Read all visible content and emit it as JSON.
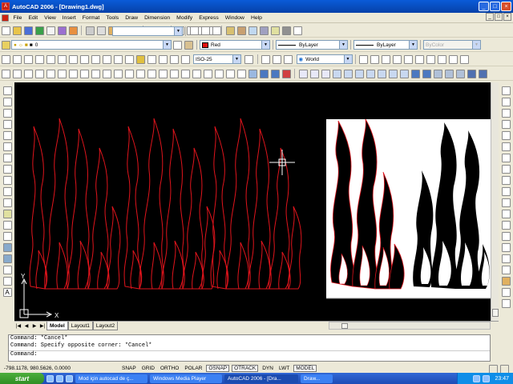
{
  "window": {
    "title": "AutoCAD 2006 - [Drawing1.dwg]",
    "logo_text": "A",
    "minimize": "_",
    "maximize": "□",
    "close": "×"
  },
  "menubar": [
    "File",
    "Edit",
    "View",
    "Insert",
    "Format",
    "Tools",
    "Draw",
    "Dimension",
    "Modify",
    "Express",
    "Window",
    "Help"
  ],
  "mdi_controls": {
    "minimize": "_",
    "restore": "□",
    "close": "×"
  },
  "toolbar_std": {
    "workspace_value": ""
  },
  "toolbar_layers": {
    "layer_value": "0",
    "color_value": "Red",
    "linetype_value": "ByLayer",
    "lineweight_value": "ByLayer",
    "plotstyle_value": "ByColor"
  },
  "toolbar_dim": {
    "dimstyle_value": "ISO-25",
    "ucs_value": "World"
  },
  "tabs": {
    "nav": [
      "|◀",
      "◀",
      "▶",
      "▶|"
    ],
    "items": [
      "Model",
      "Layout1",
      "Layout2"
    ]
  },
  "ucs": {
    "x": "X",
    "y": "Y"
  },
  "command": {
    "lines": [
      "Command: *Cancel*",
      "Command: Specify opposite corner: *Cancel*"
    ],
    "prompt": "Command:"
  },
  "statusbar": {
    "coords": "-798.1178, 980.5626, 0.0000",
    "buttons": [
      "SNAP",
      "GRID",
      "ORTHO",
      "POLAR",
      "OSNAP",
      "OTRACK",
      "DYN",
      "LWT",
      "MODEL"
    ]
  },
  "taskbar": {
    "start": "start",
    "tasks": [
      "Mod için autocad de ç...",
      "Windows Media Player",
      "AutoCAD 2006 - [Dra...",
      "Draw..."
    ],
    "clock": "23:47"
  },
  "colors": {
    "flame_red": "#e0141c",
    "canvas_bg": "#000000",
    "titlebar": "#0a5bd8",
    "taskbar": "#245edb"
  }
}
